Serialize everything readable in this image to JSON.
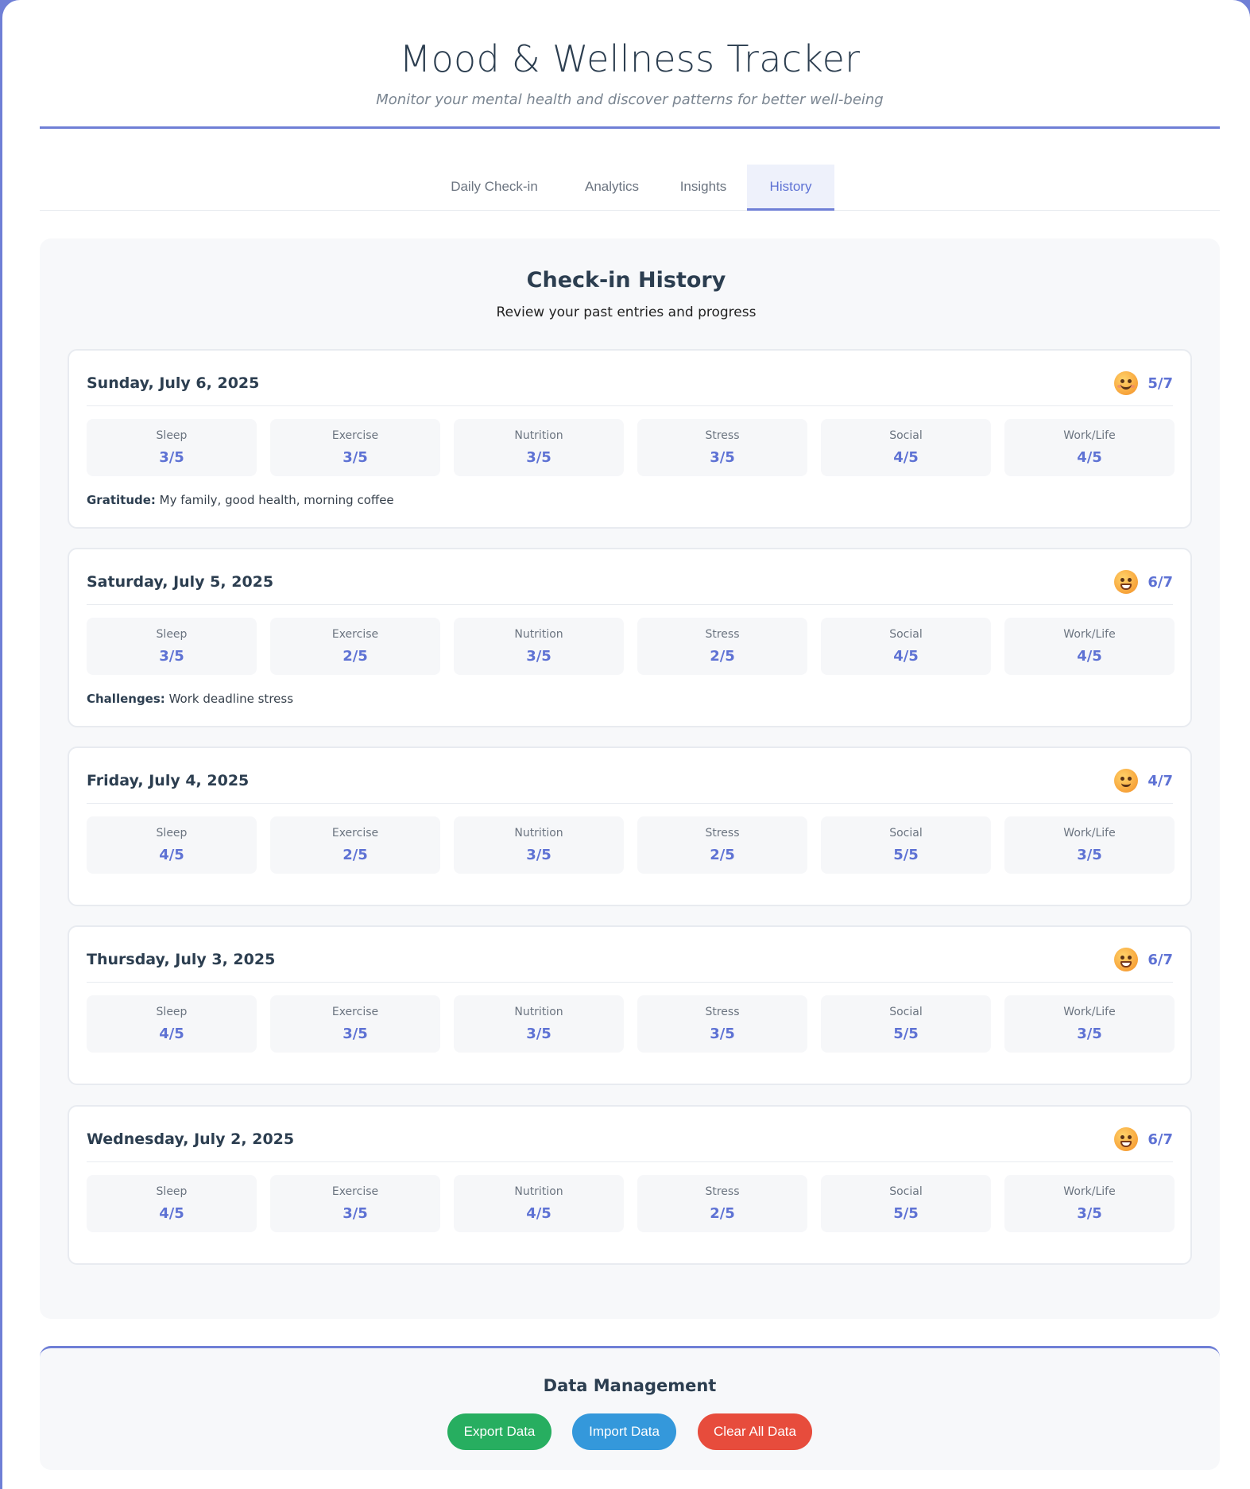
{
  "header": {
    "title": "Mood & Wellness Tracker",
    "subtitle": "Monitor your mental health and discover patterns for better well-being"
  },
  "tabs": [
    {
      "label": "Daily Check-in",
      "active": false
    },
    {
      "label": "Analytics",
      "active": false
    },
    {
      "label": "Insights",
      "active": false
    },
    {
      "label": "History",
      "active": true
    }
  ],
  "history": {
    "title": "Check-in History",
    "subtitle": "Review your past entries and progress",
    "entries": [
      {
        "date": "Sunday, July 6, 2025",
        "mood_icon": "smiling-face-icon",
        "mood": "5/7",
        "metrics": [
          {
            "label": "Sleep",
            "value": "3/5"
          },
          {
            "label": "Exercise",
            "value": "3/5"
          },
          {
            "label": "Nutrition",
            "value": "3/5"
          },
          {
            "label": "Stress",
            "value": "3/5"
          },
          {
            "label": "Social",
            "value": "4/5"
          },
          {
            "label": "Work/Life",
            "value": "4/5"
          }
        ],
        "note_label": "Gratitude:",
        "note_text": " My family, good health, morning coffee"
      },
      {
        "date": "Saturday, July 5, 2025",
        "mood_icon": "grinning-face-icon",
        "mood": "6/7",
        "metrics": [
          {
            "label": "Sleep",
            "value": "3/5"
          },
          {
            "label": "Exercise",
            "value": "2/5"
          },
          {
            "label": "Nutrition",
            "value": "3/5"
          },
          {
            "label": "Stress",
            "value": "2/5"
          },
          {
            "label": "Social",
            "value": "4/5"
          },
          {
            "label": "Work/Life",
            "value": "4/5"
          }
        ],
        "note_label": "Challenges:",
        "note_text": " Work deadline stress"
      },
      {
        "date": "Friday, July 4, 2025",
        "mood_icon": "slightly-smiling-face-icon",
        "mood": "4/7",
        "metrics": [
          {
            "label": "Sleep",
            "value": "4/5"
          },
          {
            "label": "Exercise",
            "value": "2/5"
          },
          {
            "label": "Nutrition",
            "value": "3/5"
          },
          {
            "label": "Stress",
            "value": "2/5"
          },
          {
            "label": "Social",
            "value": "5/5"
          },
          {
            "label": "Work/Life",
            "value": "3/5"
          }
        ]
      },
      {
        "date": "Thursday, July 3, 2025",
        "mood_icon": "grinning-face-icon",
        "mood": "6/7",
        "metrics": [
          {
            "label": "Sleep",
            "value": "4/5"
          },
          {
            "label": "Exercise",
            "value": "3/5"
          },
          {
            "label": "Nutrition",
            "value": "3/5"
          },
          {
            "label": "Stress",
            "value": "3/5"
          },
          {
            "label": "Social",
            "value": "5/5"
          },
          {
            "label": "Work/Life",
            "value": "3/5"
          }
        ]
      },
      {
        "date": "Wednesday, July 2, 2025",
        "mood_icon": "grinning-face-icon",
        "mood": "6/7",
        "metrics": [
          {
            "label": "Sleep",
            "value": "4/5"
          },
          {
            "label": "Exercise",
            "value": "3/5"
          },
          {
            "label": "Nutrition",
            "value": "4/5"
          },
          {
            "label": "Stress",
            "value": "2/5"
          },
          {
            "label": "Social",
            "value": "5/5"
          },
          {
            "label": "Work/Life",
            "value": "3/5"
          }
        ]
      }
    ]
  },
  "data_management": {
    "title": "Data Management",
    "export_label": "Export Data",
    "import_label": "Import Data",
    "clear_label": "Clear All Data"
  },
  "colors": {
    "accent": "#6f7fd6",
    "value_text": "#5e72d4",
    "export": "#27ae60",
    "import": "#3498db",
    "clear": "#e74c3c"
  }
}
